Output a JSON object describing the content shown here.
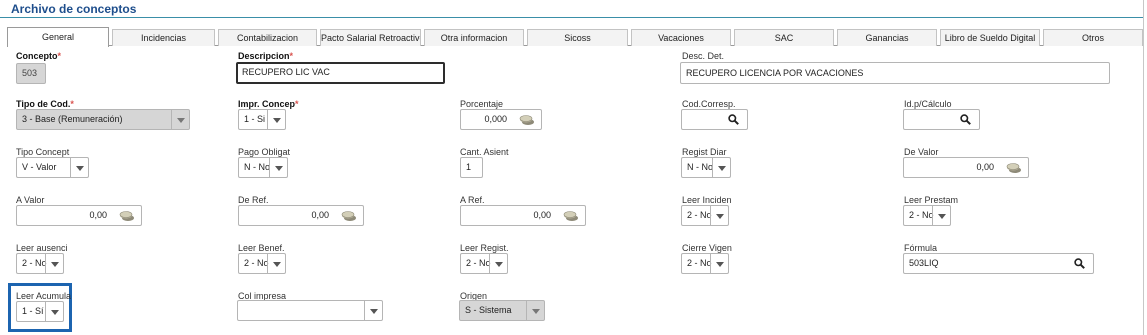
{
  "title": "Archivo de conceptos",
  "tabs": [
    "General",
    "Incidencias",
    "Contabilizacion",
    "Pacto Salarial Retroactivo",
    "Otra informacion",
    "Sicoss",
    "Vacaciones",
    "SAC",
    "Ganancias",
    "Libro de Sueldo Digital",
    "Otros"
  ],
  "required_mark": "*",
  "fields": {
    "concepto": {
      "label": "Concepto",
      "value": "503"
    },
    "descripcion": {
      "label": "Descripcion",
      "value": "RECUPERO LIC VAC"
    },
    "desc_det": {
      "label": "Desc. Det.",
      "value": "RECUPERO LICENCIA POR VACACIONES"
    },
    "tipo_cod": {
      "label": "Tipo de Cod.",
      "value": "3 - Base (Remuneración)"
    },
    "impr_concep": {
      "label": "Impr. Concep",
      "value": "1 - Si"
    },
    "porcentaje": {
      "label": "Porcentaje",
      "value": "0,000"
    },
    "cod_corresp": {
      "label": "Cod.Corresp.",
      "value": ""
    },
    "id_calculo": {
      "label": "Id.p/Cálculo",
      "value": ""
    },
    "tipo_concept": {
      "label": "Tipo Concept",
      "value": "V - Valor"
    },
    "pago_obligat": {
      "label": "Pago Obligat",
      "value": "N - No"
    },
    "cant_asient": {
      "label": "Cant. Asient",
      "value": "1"
    },
    "regist_diar": {
      "label": "Regist Diar",
      "value": "N - No"
    },
    "de_valor": {
      "label": "De Valor",
      "value": "0,00"
    },
    "a_valor": {
      "label": "A Valor",
      "value": "0,00"
    },
    "de_ref": {
      "label": "De Ref.",
      "value": "0,00"
    },
    "a_ref": {
      "label": "A Ref.",
      "value": "0,00"
    },
    "leer_inciden": {
      "label": "Leer Inciden",
      "value": "2 - No"
    },
    "leer_prestam": {
      "label": "Leer Prestam",
      "value": "2 - No"
    },
    "leer_ausenci": {
      "label": "Leer ausenci",
      "value": "2 - No"
    },
    "leer_benef": {
      "label": "Leer Benef.",
      "value": "2 - No"
    },
    "leer_regist": {
      "label": "Leer Regist.",
      "value": "2 - No"
    },
    "cierre_vigen": {
      "label": "Cierre Vigen",
      "value": "2 - No"
    },
    "formula": {
      "label": "Fórmula",
      "value": "503LIQ"
    },
    "leer_acumula": {
      "label": "Leer Acumula",
      "value": "1 - Sí"
    },
    "col_impresa": {
      "label": "Col impresa",
      "value": ""
    },
    "origen": {
      "label": "Origen",
      "value": "S - Sistema"
    }
  },
  "icons": {
    "dropdown": "chevron-down-icon",
    "lookup": "search-icon",
    "amount": "coins-icon"
  },
  "colors": {
    "title": "#1e4e8c",
    "title_rule": "#3a8fa8",
    "highlight": "#1c64b0",
    "required": "#d9534f",
    "readonly_bg": "#d6d6d6"
  }
}
